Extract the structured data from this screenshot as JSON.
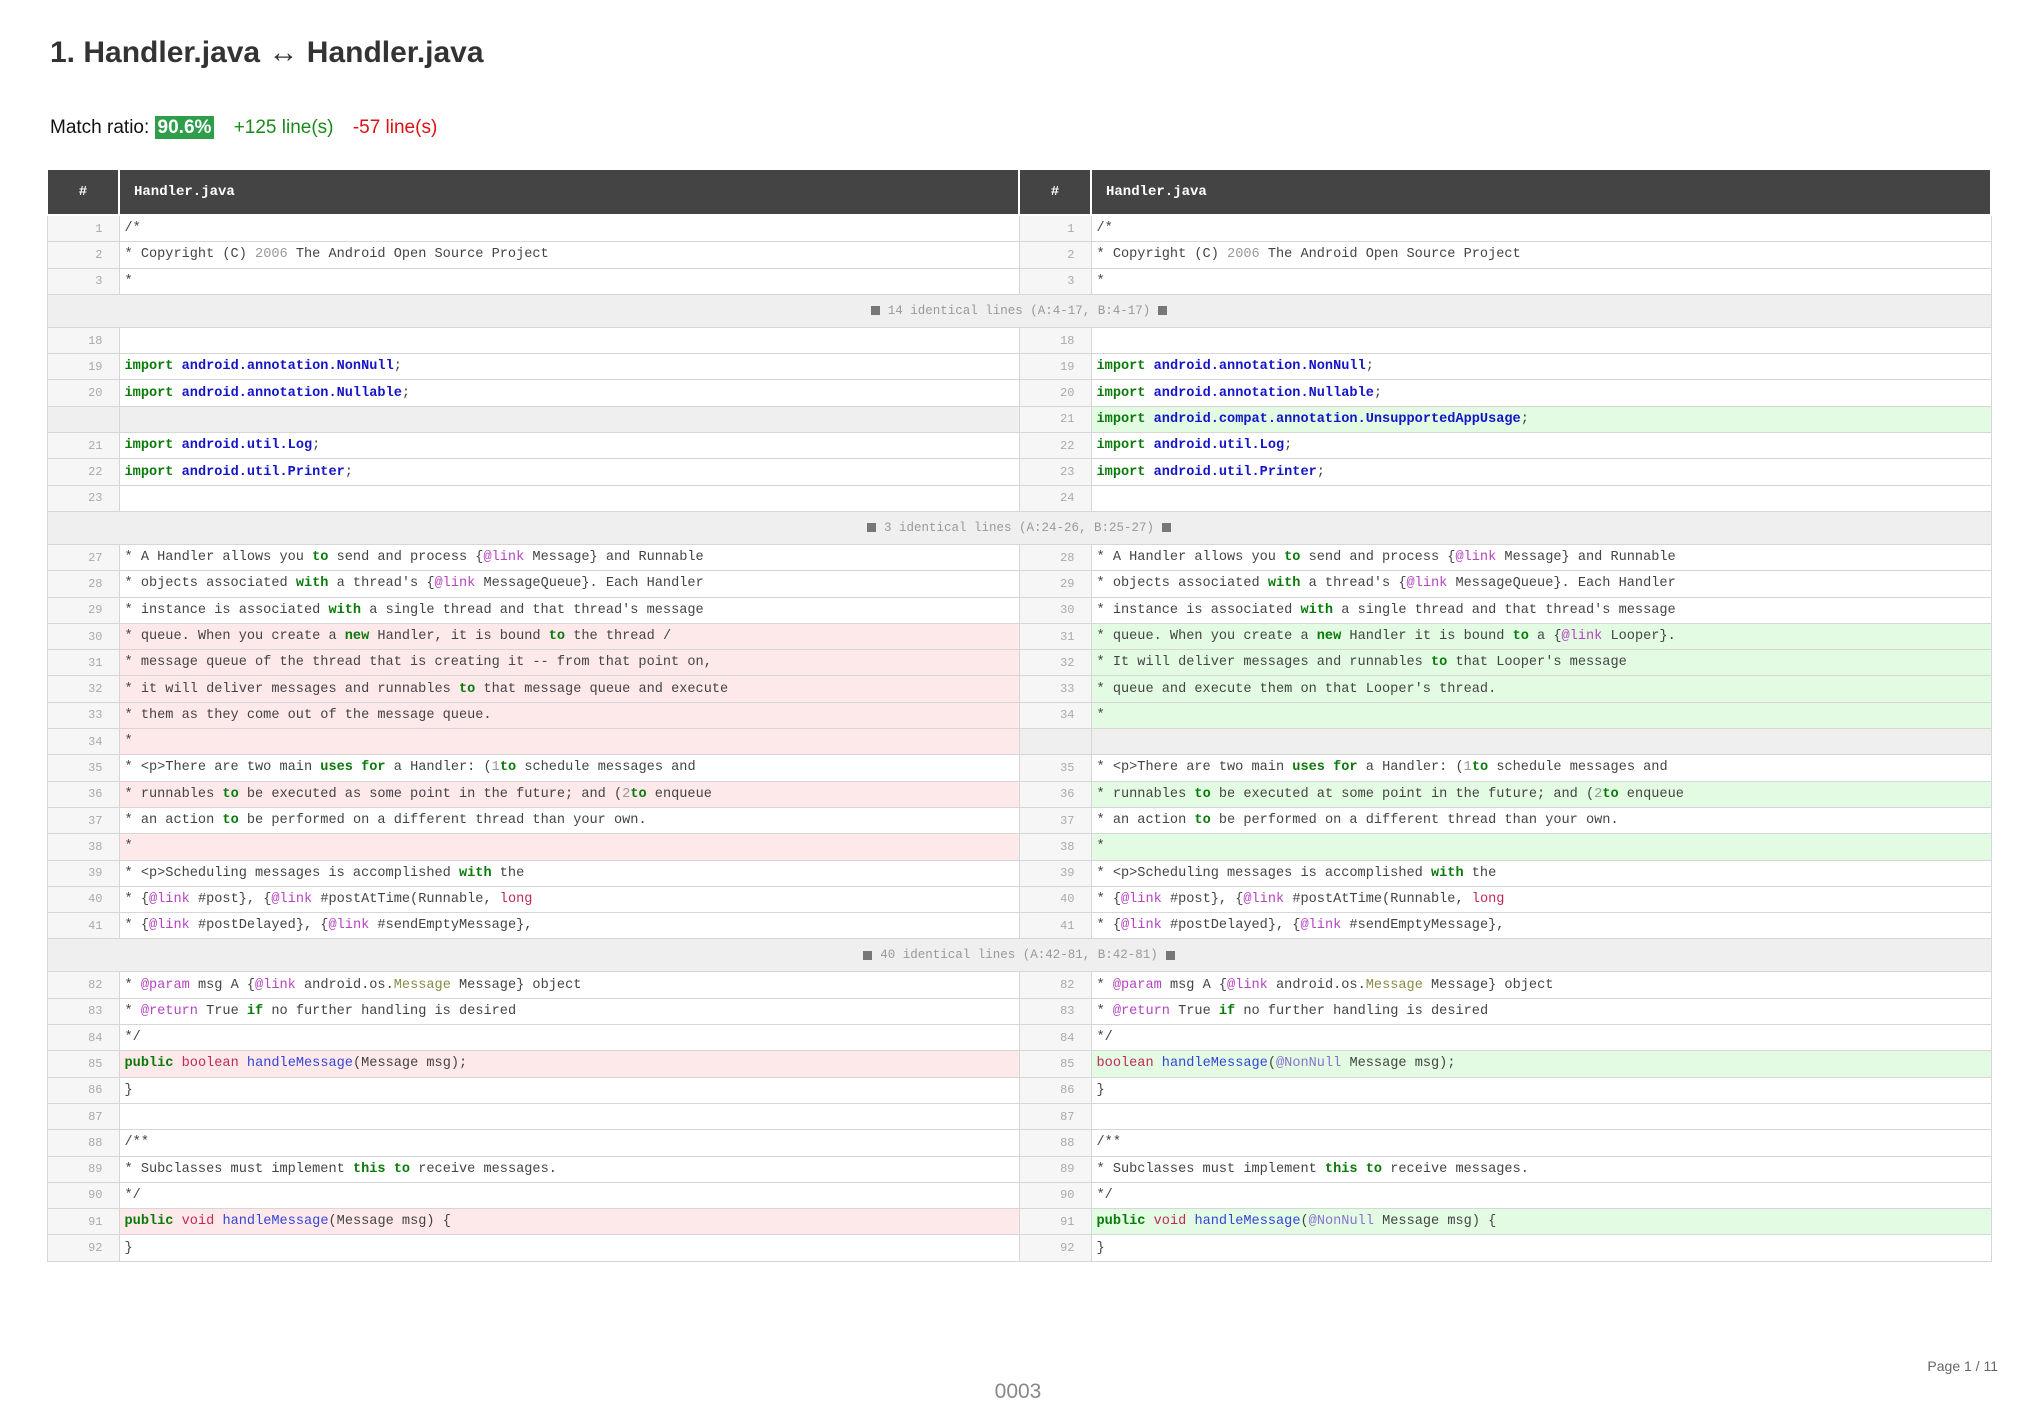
{
  "title": "1. Handler.java ↔ Handler.java",
  "summary": {
    "label": "Match ratio:",
    "ratio": "90.6%",
    "added": "+125 line(s)",
    "removed": "-57 line(s)"
  },
  "headers": {
    "num_left": "#",
    "file_left": "Handler.java",
    "num_right": "#",
    "file_right": "Handler.java"
  },
  "rows": [
    {
      "a": "1",
      "b": "1",
      "l": [
        [
          "",
          "/*"
        ]
      ],
      "r": [
        [
          "",
          "/*"
        ]
      ]
    },
    {
      "a": "2",
      "b": "2",
      "l": [
        [
          "",
          "* Copyright (C) "
        ],
        [
          "nm",
          "2006"
        ],
        [
          "",
          " The Android Open Source Project"
        ]
      ],
      "r": [
        [
          "",
          "* Copyright (C) "
        ],
        [
          "nm",
          "2006"
        ],
        [
          "",
          " The Android Open Source Project"
        ]
      ]
    },
    {
      "a": "3",
      "b": "3",
      "l": [
        [
          "",
          "*"
        ]
      ],
      "r": [
        [
          "",
          "*"
        ]
      ]
    },
    {
      "fold": "14 identical lines (A:4-17, B:4-17)"
    },
    {
      "a": "18",
      "b": "18",
      "l": [],
      "r": []
    },
    {
      "a": "19",
      "b": "19",
      "l": [
        [
          "k",
          "import"
        ],
        [
          "",
          " "
        ],
        [
          "pk",
          "android.annotation.NonNull"
        ],
        [
          "",
          ";"
        ]
      ],
      "r": [
        [
          "k",
          "import"
        ],
        [
          "",
          " "
        ],
        [
          "pk",
          "android.annotation.NonNull"
        ],
        [
          "",
          ";"
        ]
      ]
    },
    {
      "a": "20",
      "b": "20",
      "l": [
        [
          "k",
          "import"
        ],
        [
          "",
          " "
        ],
        [
          "pk",
          "android.annotation.Nullable"
        ],
        [
          "",
          ";"
        ]
      ],
      "r": [
        [
          "k",
          "import"
        ],
        [
          "",
          " "
        ],
        [
          "pk",
          "android.annotation.Nullable"
        ],
        [
          "",
          ";"
        ]
      ]
    },
    {
      "a": "",
      "b": "21",
      "lt": "blank",
      "rt": "add",
      "l": [],
      "r": [
        [
          "k",
          "import"
        ],
        [
          "",
          " "
        ],
        [
          "pk",
          "android.compat.annotation.UnsupportedAppUsage"
        ],
        [
          "",
          ";"
        ]
      ]
    },
    {
      "a": "21",
      "b": "22",
      "l": [
        [
          "k",
          "import"
        ],
        [
          "",
          " "
        ],
        [
          "pk",
          "android.util.Log"
        ],
        [
          "",
          ";"
        ]
      ],
      "r": [
        [
          "k",
          "import"
        ],
        [
          "",
          " "
        ],
        [
          "pk",
          "android.util.Log"
        ],
        [
          "",
          ";"
        ]
      ]
    },
    {
      "a": "22",
      "b": "23",
      "l": [
        [
          "k",
          "import"
        ],
        [
          "",
          " "
        ],
        [
          "pk",
          "android.util.Printer"
        ],
        [
          "",
          ";"
        ]
      ],
      "r": [
        [
          "k",
          "import"
        ],
        [
          "",
          " "
        ],
        [
          "pk",
          "android.util.Printer"
        ],
        [
          "",
          ";"
        ]
      ]
    },
    {
      "a": "23",
      "b": "24",
      "l": [],
      "r": []
    },
    {
      "fold": "3 identical lines (A:24-26, B:25-27)"
    },
    {
      "a": "27",
      "b": "28",
      "l": [
        [
          "",
          "* A Handler allows you "
        ],
        [
          "k",
          "to"
        ],
        [
          "",
          " send and process {"
        ],
        [
          "tg",
          "@link"
        ],
        [
          "",
          " Message} and Runnable"
        ]
      ],
      "r": [
        [
          "",
          "* A Handler allows you "
        ],
        [
          "k",
          "to"
        ],
        [
          "",
          " send and process {"
        ],
        [
          "tg",
          "@link"
        ],
        [
          "",
          " Message} and Runnable"
        ]
      ]
    },
    {
      "a": "28",
      "b": "29",
      "l": [
        [
          "",
          "* objects associated "
        ],
        [
          "k",
          "with"
        ],
        [
          "",
          " a thread's {"
        ],
        [
          "tg",
          "@link"
        ],
        [
          "",
          " MessageQueue}. Each Handler"
        ]
      ],
      "r": [
        [
          "",
          "* objects associated "
        ],
        [
          "k",
          "with"
        ],
        [
          "",
          " a thread's {"
        ],
        [
          "tg",
          "@link"
        ],
        [
          "",
          " MessageQueue}. Each Handler"
        ]
      ]
    },
    {
      "a": "29",
      "b": "30",
      "l": [
        [
          "",
          "* instance is associated "
        ],
        [
          "k",
          "with"
        ],
        [
          "",
          " a single thread and that thread's message"
        ]
      ],
      "r": [
        [
          "",
          "* instance is associated "
        ],
        [
          "k",
          "with"
        ],
        [
          "",
          " a single thread and that thread's message"
        ]
      ]
    },
    {
      "a": "30",
      "b": "31",
      "lt": "del",
      "rt": "add",
      "l": [
        [
          "",
          "* queue. When you create a "
        ],
        [
          "k",
          "new"
        ],
        [
          "",
          " Handler, it is bound "
        ],
        [
          "k",
          "to"
        ],
        [
          "",
          " the thread /"
        ]
      ],
      "r": [
        [
          "",
          "* queue. When you create a "
        ],
        [
          "k",
          "new"
        ],
        [
          "",
          " Handler it is bound "
        ],
        [
          "k",
          "to"
        ],
        [
          "",
          " a {"
        ],
        [
          "tg",
          "@link"
        ],
        [
          "",
          " Looper}."
        ]
      ]
    },
    {
      "a": "31",
      "b": "32",
      "lt": "del",
      "rt": "add",
      "l": [
        [
          "",
          "* message queue of the thread that is creating it -- from that point on,"
        ]
      ],
      "r": [
        [
          "",
          "* It will deliver messages and runnables "
        ],
        [
          "k",
          "to"
        ],
        [
          "",
          " that Looper's message"
        ]
      ]
    },
    {
      "a": "32",
      "b": "33",
      "lt": "del",
      "rt": "add",
      "l": [
        [
          "",
          "* it will deliver messages and runnables "
        ],
        [
          "k",
          "to"
        ],
        [
          "",
          " that message queue and execute"
        ]
      ],
      "r": [
        [
          "",
          "* queue and execute them on that Looper's thread."
        ]
      ]
    },
    {
      "a": "33",
      "b": "34",
      "lt": "del",
      "rt": "add",
      "l": [
        [
          "",
          "* them as they come out of the message queue."
        ]
      ],
      "r": [
        [
          "",
          "*"
        ]
      ]
    },
    {
      "a": "34",
      "b": "",
      "lt": "del",
      "rt": "blank",
      "l": [
        [
          "",
          "*"
        ]
      ],
      "r": []
    },
    {
      "a": "35",
      "b": "35",
      "l": [
        [
          "",
          "* <p>There are two main "
        ],
        [
          "k",
          "uses"
        ],
        [
          "",
          " "
        ],
        [
          "k",
          "for"
        ],
        [
          "",
          " a Handler: ("
        ],
        [
          "nm",
          "1"
        ],
        [
          ") "
        ],
        [
          "k",
          "to"
        ],
        [
          "",
          " schedule messages and"
        ]
      ],
      "r": [
        [
          "",
          "* <p>There are two main "
        ],
        [
          "k",
          "uses"
        ],
        [
          "",
          " "
        ],
        [
          "k",
          "for"
        ],
        [
          "",
          " a Handler: ("
        ],
        [
          "nm",
          "1"
        ],
        [
          ") "
        ],
        [
          "k",
          "to"
        ],
        [
          "",
          " schedule messages and"
        ]
      ]
    },
    {
      "a": "36",
      "b": "36",
      "lt": "del",
      "rt": "add",
      "l": [
        [
          "",
          "* runnables "
        ],
        [
          "k",
          "to"
        ],
        [
          "",
          " be executed as some point in the future; and ("
        ],
        [
          "nm",
          "2"
        ],
        [
          ") "
        ],
        [
          "k",
          "to"
        ],
        [
          "",
          " enqueue"
        ]
      ],
      "r": [
        [
          "",
          "* runnables "
        ],
        [
          "k",
          "to"
        ],
        [
          "",
          " be executed at some point in the future; and ("
        ],
        [
          "nm",
          "2"
        ],
        [
          ") "
        ],
        [
          "k",
          "to"
        ],
        [
          "",
          " enqueue"
        ]
      ]
    },
    {
      "a": "37",
      "b": "37",
      "l": [
        [
          "",
          "* an action "
        ],
        [
          "k",
          "to"
        ],
        [
          "",
          " be performed on a different thread than your own."
        ]
      ],
      "r": [
        [
          "",
          "* an action "
        ],
        [
          "k",
          "to"
        ],
        [
          "",
          " be performed on a different thread than your own."
        ]
      ]
    },
    {
      "a": "38",
      "b": "38",
      "lt": "del",
      "rt": "add",
      "l": [
        [
          "",
          "*"
        ]
      ],
      "r": [
        [
          "",
          "*"
        ]
      ]
    },
    {
      "a": "39",
      "b": "39",
      "l": [
        [
          "",
          "* <p>Scheduling messages is accomplished "
        ],
        [
          "k",
          "with"
        ],
        [
          "",
          " the"
        ]
      ],
      "r": [
        [
          "",
          "* <p>Scheduling messages is accomplished "
        ],
        [
          "k",
          "with"
        ],
        [
          "",
          " the"
        ]
      ]
    },
    {
      "a": "40",
      "b": "40",
      "l": [
        [
          "",
          "* {"
        ],
        [
          "tg",
          "@link"
        ],
        [
          "",
          " #post}, {"
        ],
        [
          "tg",
          "@link"
        ],
        [
          "",
          " #postAtTime(Runnable, "
        ],
        [
          "ty",
          "long"
        ],
        [
          ")},"
        ]
      ],
      "r": [
        [
          "",
          "* {"
        ],
        [
          "tg",
          "@link"
        ],
        [
          "",
          " #post}, {"
        ],
        [
          "tg",
          "@link"
        ],
        [
          "",
          " #postAtTime(Runnable, "
        ],
        [
          "ty",
          "long"
        ],
        [
          ")},"
        ]
      ]
    },
    {
      "a": "41",
      "b": "41",
      "l": [
        [
          "",
          "* {"
        ],
        [
          "tg",
          "@link"
        ],
        [
          "",
          " #postDelayed}, {"
        ],
        [
          "tg",
          "@link"
        ],
        [
          "",
          " #sendEmptyMessage},"
        ]
      ],
      "r": [
        [
          "",
          "* {"
        ],
        [
          "tg",
          "@link"
        ],
        [
          "",
          " #postDelayed}, {"
        ],
        [
          "tg",
          "@link"
        ],
        [
          "",
          " #sendEmptyMessage},"
        ]
      ]
    },
    {
      "fold": "40 identical lines (A:42-81, B:42-81)"
    },
    {
      "a": "82",
      "b": "82",
      "l": [
        [
          "",
          "* "
        ],
        [
          "tg",
          "@param"
        ],
        [
          "",
          " msg A {"
        ],
        [
          "tg",
          "@link"
        ],
        [
          "",
          " android.os."
        ],
        [
          "cl",
          "Message"
        ],
        [
          "",
          " Message} object"
        ]
      ],
      "r": [
        [
          "",
          "* "
        ],
        [
          "tg",
          "@param"
        ],
        [
          "",
          " msg A {"
        ],
        [
          "tg",
          "@link"
        ],
        [
          "",
          " android.os."
        ],
        [
          "cl",
          "Message"
        ],
        [
          "",
          " Message} object"
        ]
      ]
    },
    {
      "a": "83",
      "b": "83",
      "l": [
        [
          "",
          "* "
        ],
        [
          "tg",
          "@return"
        ],
        [
          "",
          " True "
        ],
        [
          "k",
          "if"
        ],
        [
          "",
          " no further handling is desired"
        ]
      ],
      "r": [
        [
          "",
          "* "
        ],
        [
          "tg",
          "@return"
        ],
        [
          "",
          " True "
        ],
        [
          "k",
          "if"
        ],
        [
          "",
          " no further handling is desired"
        ]
      ]
    },
    {
      "a": "84",
      "b": "84",
      "l": [
        [
          "",
          "*/"
        ]
      ],
      "r": [
        [
          "",
          "*/"
        ]
      ]
    },
    {
      "a": "85",
      "b": "85",
      "lt": "del",
      "rt": "add",
      "l": [
        [
          "k",
          "public"
        ],
        [
          "",
          " "
        ],
        [
          "ty",
          "boolean"
        ],
        [
          "",
          " "
        ],
        [
          "fn",
          "handleMessage"
        ],
        [
          "",
          "(Message msg);"
        ]
      ],
      "r": [
        [
          "ty",
          "boolean"
        ],
        [
          "",
          " "
        ],
        [
          "fn",
          "handleMessage"
        ],
        [
          "",
          "("
        ],
        [
          "an",
          "@NonNull"
        ],
        [
          "",
          " Message msg);"
        ]
      ]
    },
    {
      "a": "86",
      "b": "86",
      "l": [
        [
          "",
          "}"
        ]
      ],
      "r": [
        [
          "",
          "}"
        ]
      ]
    },
    {
      "a": "87",
      "b": "87",
      "l": [],
      "r": []
    },
    {
      "a": "88",
      "b": "88",
      "l": [
        [
          "",
          "/**"
        ]
      ],
      "r": [
        [
          "",
          "/**"
        ]
      ]
    },
    {
      "a": "89",
      "b": "89",
      "l": [
        [
          "",
          "* Subclasses must implement "
        ],
        [
          "k",
          "this"
        ],
        [
          "",
          " "
        ],
        [
          "k",
          "to"
        ],
        [
          "",
          " receive messages."
        ]
      ],
      "r": [
        [
          "",
          "* Subclasses must implement "
        ],
        [
          "k",
          "this"
        ],
        [
          "",
          " "
        ],
        [
          "k",
          "to"
        ],
        [
          "",
          " receive messages."
        ]
      ]
    },
    {
      "a": "90",
      "b": "90",
      "l": [
        [
          "",
          "*/"
        ]
      ],
      "r": [
        [
          "",
          "*/"
        ]
      ]
    },
    {
      "a": "91",
      "b": "91",
      "lt": "del",
      "rt": "add",
      "l": [
        [
          "k",
          "public"
        ],
        [
          "",
          " "
        ],
        [
          "ty",
          "void"
        ],
        [
          "",
          " "
        ],
        [
          "fn",
          "handleMessage"
        ],
        [
          "",
          "(Message msg) {"
        ]
      ],
      "r": [
        [
          "k",
          "public"
        ],
        [
          "",
          " "
        ],
        [
          "ty",
          "void"
        ],
        [
          "",
          " "
        ],
        [
          "fn",
          "handleMessage"
        ],
        [
          "",
          "("
        ],
        [
          "an",
          "@NonNull"
        ],
        [
          "",
          " Message msg) {"
        ]
      ]
    },
    {
      "a": "92",
      "b": "92",
      "l": [
        [
          "",
          "}"
        ]
      ],
      "r": [
        [
          "",
          "}"
        ]
      ]
    }
  ],
  "footer": {
    "page": "Page 1 / 11",
    "number": "0003"
  }
}
